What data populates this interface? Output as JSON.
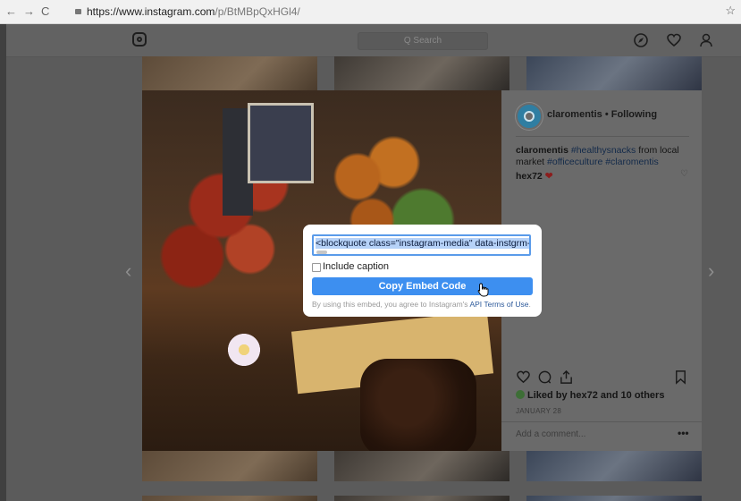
{
  "browser": {
    "back": "←",
    "forward": "→",
    "reload": "C",
    "url_host": "https://www.instagram.com",
    "url_path": "/p/BtMBpQxHGl4/",
    "star": "☆"
  },
  "header": {
    "search_placeholder": "Q Search",
    "icons": [
      "instagram-logo",
      "compass-icon",
      "heart-icon",
      "profile-icon"
    ]
  },
  "post": {
    "username": "claromentis",
    "follow_state": "• Following",
    "caption_user": "claromentis",
    "caption_tag1": "#healthysnacks",
    "caption_text1": "from local market",
    "caption_tag2": "#officeculture",
    "caption_tag3": "#claromentis",
    "comment_user": "hex72",
    "comment_heart": "❤",
    "likes": "Liked by hex72 and 10 others",
    "date": "JANUARY 28",
    "add_comment": "Add a comment...",
    "more": "•••"
  },
  "embed_modal": {
    "code": "<blockquote class=\"instagram-media\" data-instgrm-per",
    "include_caption_label": "Include caption",
    "include_caption_checked": false,
    "copy_button": "Copy Embed Code",
    "note_prefix": "By using this embed, you agree to Instagram's",
    "note_link": "API Terms of Use",
    "note_suffix": "."
  },
  "nav_arrows": {
    "prev": "‹",
    "next": "›"
  }
}
